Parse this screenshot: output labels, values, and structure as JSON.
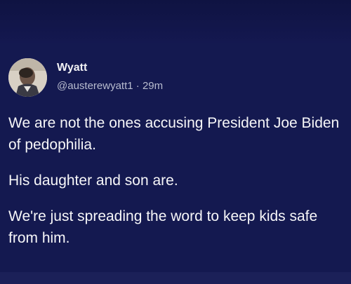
{
  "post": {
    "author": {
      "display_name": "Wyatt",
      "handle": "@austerewyatt1",
      "separator": "·",
      "time": "29m",
      "avatar_icon": "user-avatar"
    },
    "paragraphs": [
      "We are not the ones accusing President Joe Biden of pedophilia.",
      "His daughter and son are.",
      "We're just spreading the word to keep kids safe from him."
    ]
  },
  "colors": {
    "background": "#12164d",
    "text": "#f6f6f8",
    "muted_text": "#b8bccf"
  }
}
